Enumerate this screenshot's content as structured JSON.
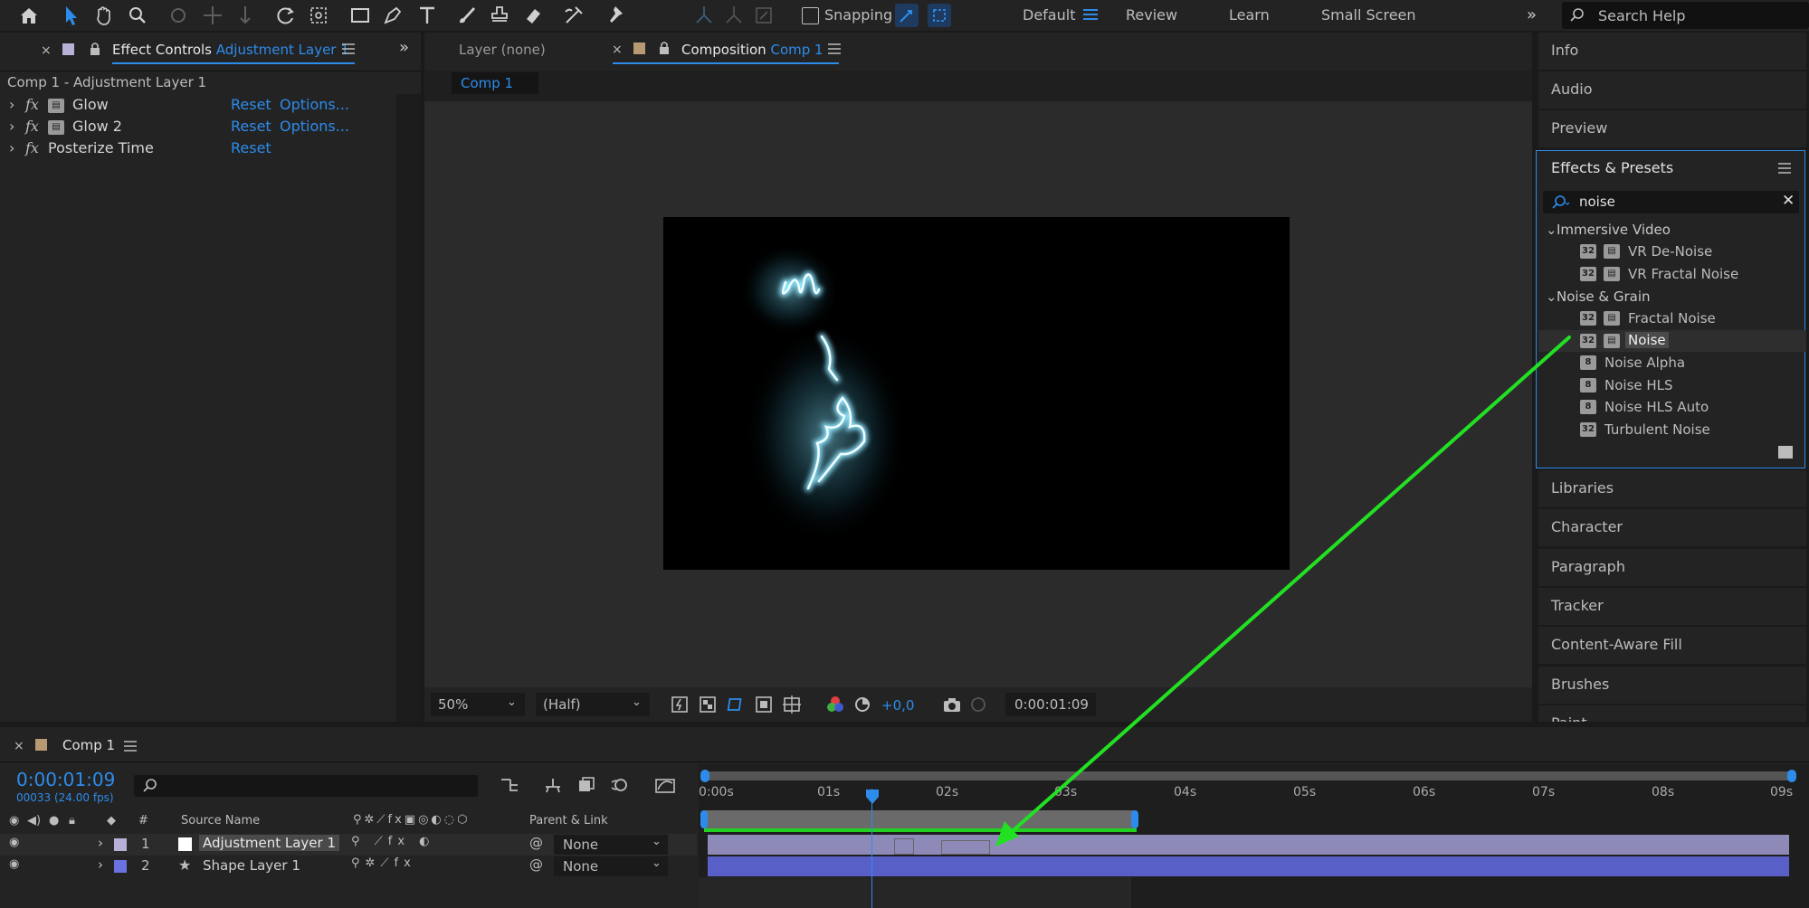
{
  "toolbar": {
    "snapping_label": "Snapping",
    "workspaces": [
      "Default",
      "Review",
      "Learn",
      "Small Screen"
    ],
    "search_placeholder": "Search Help"
  },
  "effect_controls": {
    "tab_prefix": "Effect Controls",
    "tab_layer": "Adjustment Layer 1",
    "breadcrumb": "Comp 1 - Adjustment Layer 1",
    "effects": [
      {
        "name": "Glow",
        "reset": "Reset",
        "options": "Options..."
      },
      {
        "name": "Glow 2",
        "reset": "Reset",
        "options": "Options..."
      },
      {
        "name": "Posterize Time",
        "reset": "Reset",
        "options": ""
      }
    ]
  },
  "viewer": {
    "layer_tab": "Layer (none)",
    "comp_tab_prefix": "Composition",
    "comp_tab_name": "Comp 1",
    "comp_subtab": "Comp 1",
    "zoom": "50%",
    "resolution": "(Half)",
    "exposure": "+0,0",
    "timecode": "0:00:01:09"
  },
  "right_panel": {
    "top_items": [
      "Info",
      "Audio",
      "Preview"
    ],
    "effects_presets": {
      "title": "Effects & Presets",
      "search_value": "noise",
      "groups": [
        {
          "name": "Immersive Video",
          "items": [
            {
              "label": "VR De-Noise",
              "bit": "32",
              "fx": true
            },
            {
              "label": "VR Fractal Noise",
              "bit": "32",
              "fx": true
            }
          ]
        },
        {
          "name": "Noise & Grain",
          "items": [
            {
              "label": "Fractal Noise",
              "bit": "32",
              "fx": true
            },
            {
              "label": "Noise",
              "bit": "32",
              "fx": true
            },
            {
              "label": "Noise Alpha",
              "bit": "8",
              "fx": false
            },
            {
              "label": "Noise HLS",
              "bit": "8",
              "fx": false
            },
            {
              "label": "Noise HLS Auto",
              "bit": "8",
              "fx": false
            },
            {
              "label": "Turbulent Noise",
              "bit": "32",
              "fx": false
            }
          ]
        }
      ]
    },
    "bottom_items": [
      "Libraries",
      "Character",
      "Paragraph",
      "Tracker",
      "Content-Aware Fill",
      "Brushes",
      "Paint"
    ]
  },
  "timeline": {
    "comp_tab": "Comp 1",
    "current_time": "0:00:01:09",
    "frame_info": "00033 (24.00 fps)",
    "ruler_ticks": [
      "0:00s",
      "01s",
      "02s",
      "03s",
      "04s",
      "05s",
      "06s",
      "07s",
      "08s",
      "09s"
    ],
    "columns": {
      "number": "#",
      "source_name": "Source Name",
      "parent_link": "Parent & Link"
    },
    "layers": [
      {
        "index": "1",
        "name": "Adjustment Layer 1",
        "parent": "None",
        "color": "#b9b0d8"
      },
      {
        "index": "2",
        "name": "Shape Layer 1",
        "parent": "None",
        "color": "#6a72e0"
      }
    ]
  },
  "colors": {
    "accent": "#2d8ceb",
    "arrow": "#22e022",
    "panel_bg": "#232323",
    "app_bg": "#1a1a1a"
  }
}
